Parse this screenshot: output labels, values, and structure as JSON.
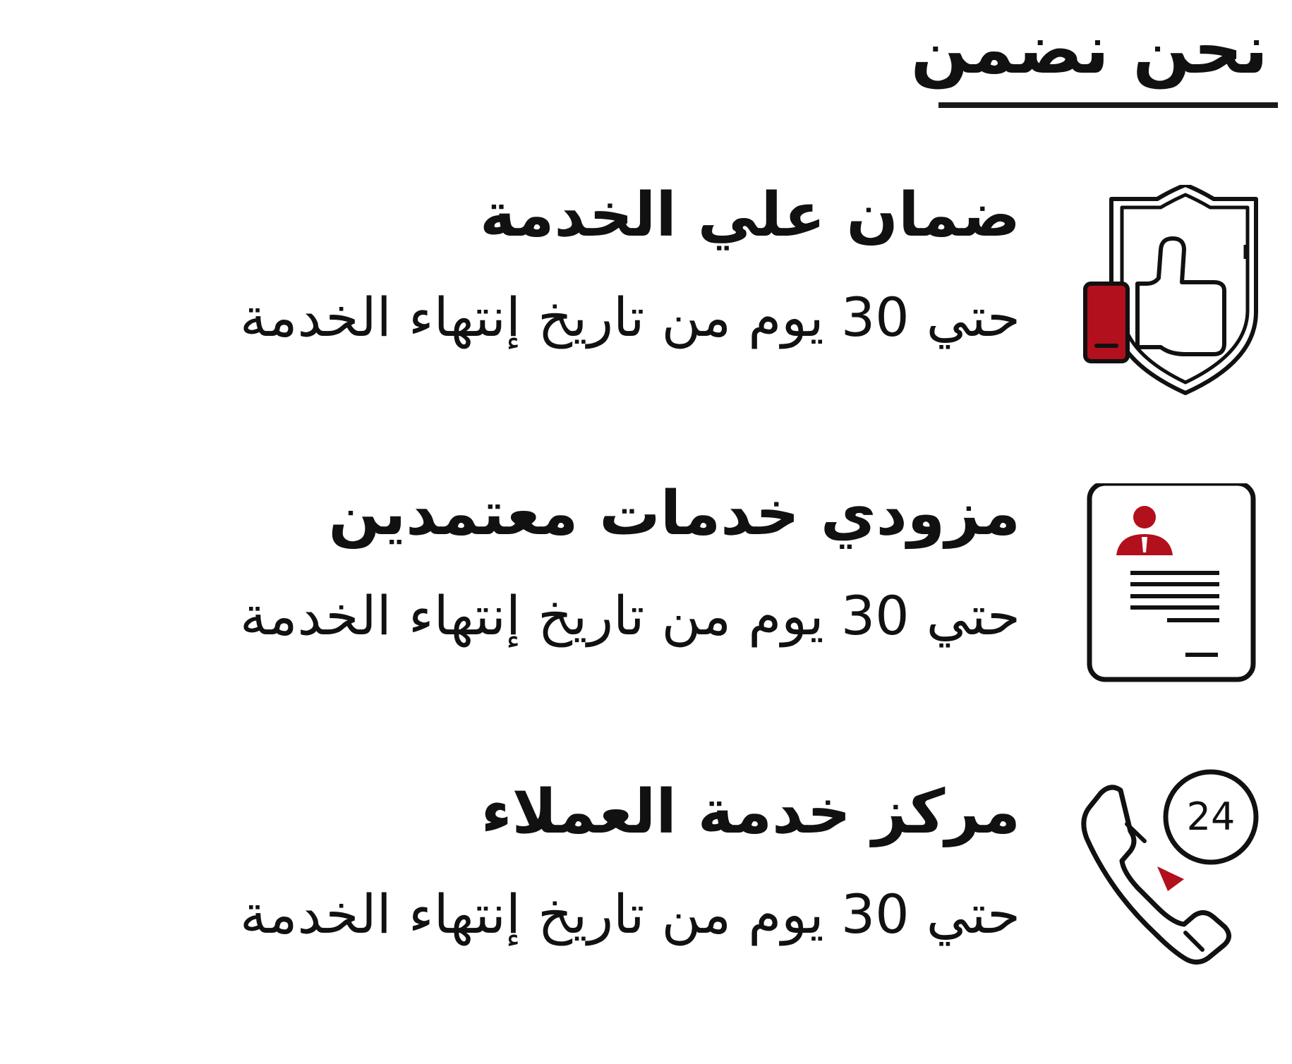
{
  "heading": "نحن نضمن",
  "colors": {
    "accent": "#b2101c",
    "ink": "#111111"
  },
  "features": [
    {
      "icon": "shield-thumbs-up-icon",
      "title": "ضمان علي الخدمة",
      "description": "حتي 30 يوم من تاريخ إنتهاء الخدمة"
    },
    {
      "icon": "certified-profile-document-icon",
      "title": "مزودي خدمات معتمدين",
      "description": "حتي 30 يوم من تاريخ إنتهاء الخدمة"
    },
    {
      "icon": "phone-24-hours-icon",
      "title": "مركز خدمة العملاء",
      "icon_label": "24",
      "description": "حتي 30 يوم من تاريخ إنتهاء الخدمة"
    }
  ]
}
